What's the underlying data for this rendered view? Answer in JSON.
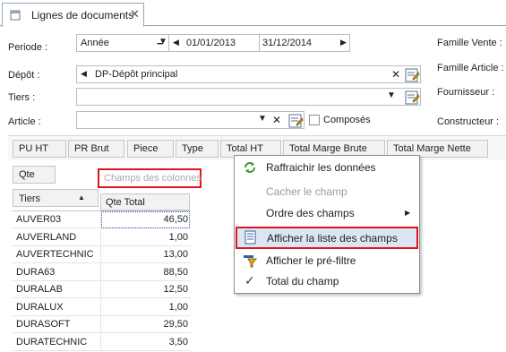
{
  "tab": {
    "title": "Lignes de documents",
    "close": "✕"
  },
  "filters": {
    "periode": {
      "label": "Periode :",
      "mode": "Année",
      "date_from": "01/01/2013",
      "date_to": "31/12/2014"
    },
    "depot": {
      "label": "Dépôt :",
      "value": "DP-Dépôt principal"
    },
    "tiers": {
      "label": "Tiers :",
      "value": ""
    },
    "article": {
      "label": "Article :",
      "value": "",
      "composes_label": "Composés"
    },
    "right_labels": [
      "Famille Vente :",
      "Famille Article :",
      "Fournisseur :",
      "Constructeur :"
    ]
  },
  "pivot": {
    "header_fields": [
      "PU HT",
      "PR Brut",
      "Piece",
      "Type",
      "Total HT",
      "Total Marge Brute",
      "Total Marge Nette"
    ],
    "data_field": "Qte",
    "column_area_placeholder": "Champs des colonnes",
    "row_header": "Tiers",
    "value_header": "Qte Total",
    "rows": [
      {
        "tiers": "AUVER03",
        "qte": "46,50"
      },
      {
        "tiers": "AUVERLAND",
        "qte": "1,00"
      },
      {
        "tiers": "AUVERTECHNIC",
        "qte": "13,00"
      },
      {
        "tiers": "DURA63",
        "qte": "88,50"
      },
      {
        "tiers": "DURALAB",
        "qte": "12,50"
      },
      {
        "tiers": "DURALUX",
        "qte": "1,00"
      },
      {
        "tiers": "DURASOFT",
        "qte": "29,50"
      },
      {
        "tiers": "DURATECHNIC",
        "qte": "3,50"
      }
    ]
  },
  "context_menu": {
    "items": [
      {
        "label": "Raffraichir les données",
        "icon": "refresh-icon",
        "enabled": true
      },
      {
        "label": "Cacher le champ",
        "icon": "",
        "enabled": false
      },
      {
        "label": "Ordre des champs",
        "icon": "",
        "enabled": true,
        "submenu": true
      },
      {
        "label": "Afficher la liste des champs",
        "icon": "field-list-icon",
        "enabled": true,
        "highlighted": true
      },
      {
        "label": "Afficher le pré-filtre",
        "icon": "filter-icon",
        "enabled": true
      },
      {
        "label": "Total du champ",
        "icon": "check-icon",
        "enabled": true,
        "checked": true
      }
    ]
  },
  "colors": {
    "highlight_red": "#e0141e",
    "menu_hover": "#dbe6f4",
    "border": "#b8bcc4"
  }
}
